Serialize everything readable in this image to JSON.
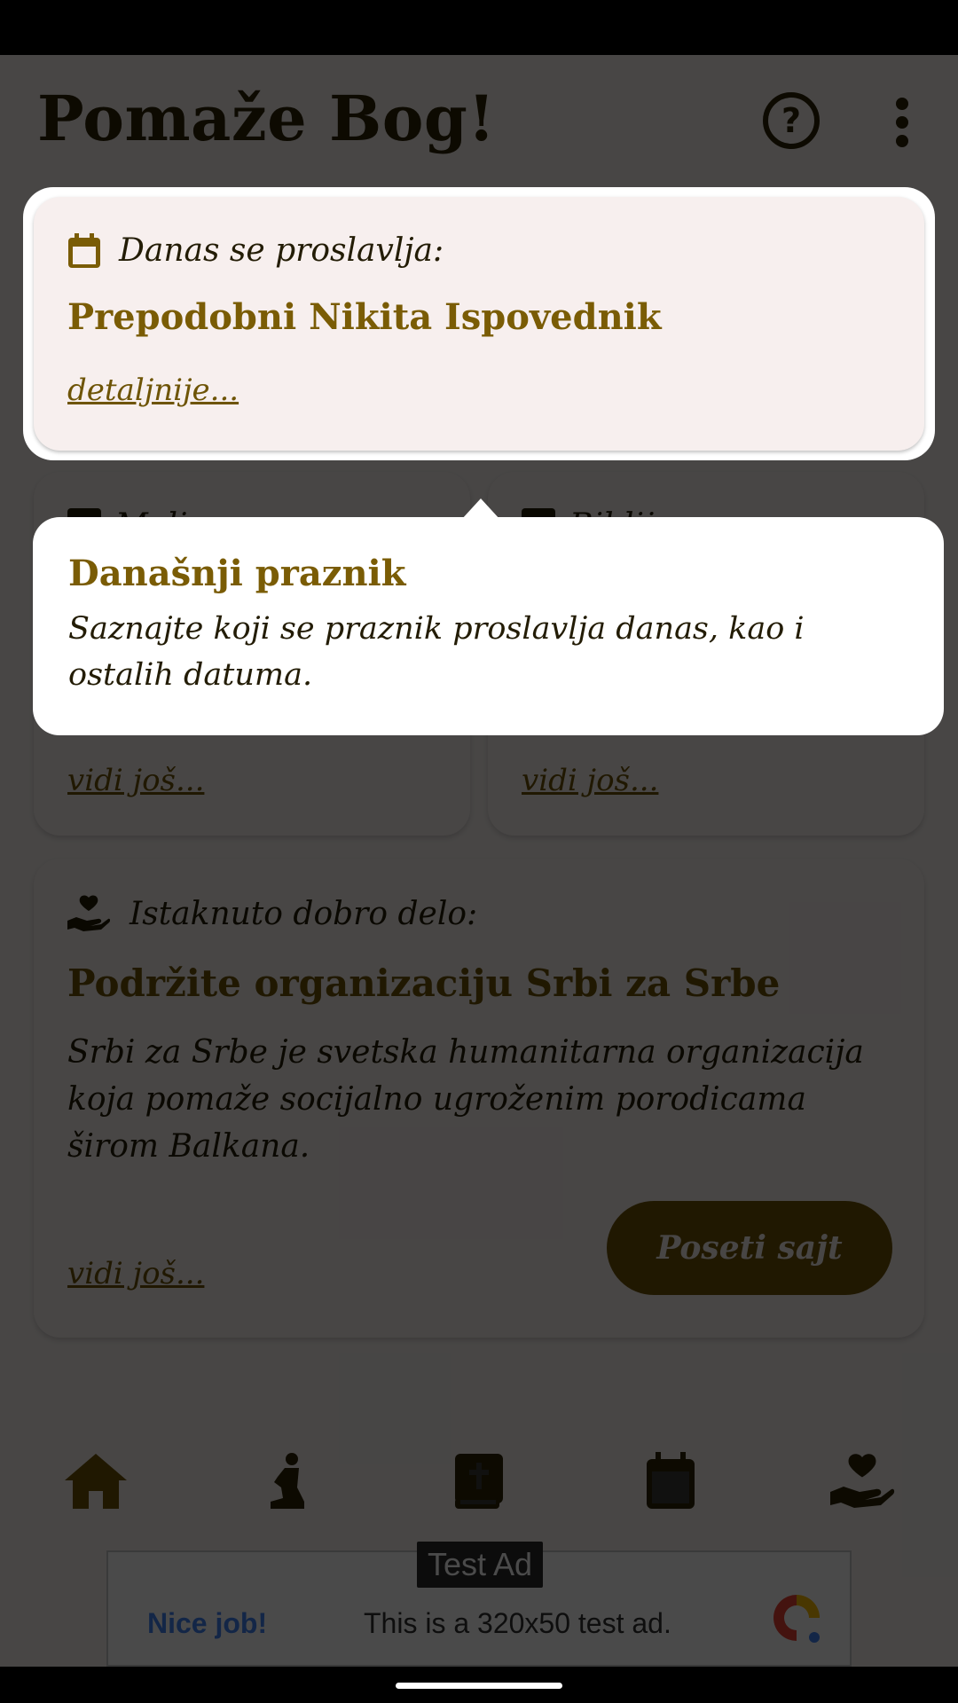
{
  "header": {
    "title": "Pomaže Bog!",
    "help_label": "?"
  },
  "feast": {
    "heading": "Danas se proslavlja:",
    "name": "Prepodobni Nikita Ispovednik",
    "link": "detaljnije..."
  },
  "mid_cards": [
    {
      "peek": "Moli...",
      "link": "vidi još..."
    },
    {
      "peek": "Biblij...",
      "link": "vidi još..."
    }
  ],
  "deed": {
    "heading": "Istaknuto dobro delo:",
    "title": "Podržite organizaciju Srbi za Srbe",
    "description": "Srbi za Srbe je svetska humanitarna organizacija koja pomaže socijalno ugroženim porodicama širom Balkana.",
    "button": "Poseti sajt",
    "link": "vidi još..."
  },
  "tooltip": {
    "title": "Današnji praznik",
    "text": "Saznajte koji se praznik proslavlja danas, kao i ostalih datuma."
  },
  "nav": {
    "items": [
      "home-icon",
      "pray-icon",
      "bible-icon",
      "calendar-icon",
      "charity-icon"
    ],
    "active": "home-icon"
  },
  "ad": {
    "badge": "Test Ad",
    "nice": "Nice job!",
    "text": "This is a 320x50 test ad."
  },
  "colors": {
    "accent": "#7a5c05",
    "dark": "#2d2306",
    "card": "#f7efee",
    "scrim": "rgba(0,0,0,0.71)"
  }
}
